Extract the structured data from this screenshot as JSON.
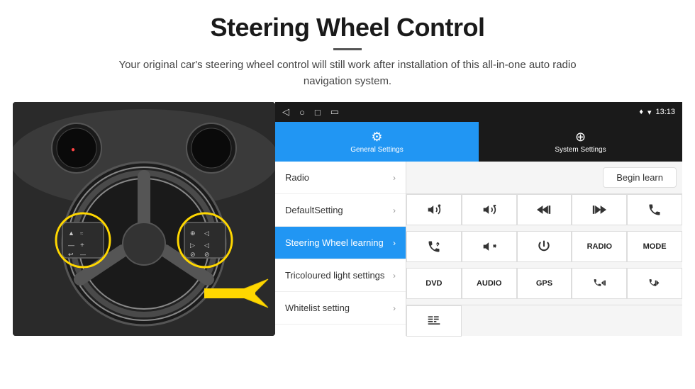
{
  "header": {
    "title": "Steering Wheel Control",
    "subtitle": "Your original car's steering wheel control will still work after installation of this all-in-one auto radio navigation system."
  },
  "status_bar": {
    "time": "13:13",
    "nav_icons": [
      "◁",
      "○",
      "□",
      "▭"
    ]
  },
  "tabs": [
    {
      "label": "General Settings",
      "active": true
    },
    {
      "label": "System Settings",
      "active": false
    }
  ],
  "menu_items": [
    {
      "label": "Radio",
      "active": false
    },
    {
      "label": "DefaultSetting",
      "active": false
    },
    {
      "label": "Steering Wheel learning",
      "active": true
    },
    {
      "label": "Tricoloured light settings",
      "active": false
    },
    {
      "label": "Whitelist setting",
      "active": false
    }
  ],
  "begin_learn_btn": "Begin learn",
  "icon_buttons": [
    {
      "type": "icon",
      "content": "vol_up",
      "row": 2
    },
    {
      "type": "icon",
      "content": "vol_down",
      "row": 2
    },
    {
      "type": "icon",
      "content": "prev",
      "row": 2
    },
    {
      "type": "icon",
      "content": "next",
      "row": 2
    },
    {
      "type": "icon",
      "content": "phone",
      "row": 2
    },
    {
      "type": "icon",
      "content": "back_call",
      "row": 3
    },
    {
      "type": "icon",
      "content": "mute",
      "row": 3
    },
    {
      "type": "icon",
      "content": "power",
      "row": 3
    },
    {
      "type": "text",
      "content": "RADIO",
      "row": 3
    },
    {
      "type": "text",
      "content": "MODE",
      "row": 3
    },
    {
      "type": "text",
      "content": "DVD",
      "row": 4
    },
    {
      "type": "text",
      "content": "AUDIO",
      "row": 4
    },
    {
      "type": "text",
      "content": "GPS",
      "row": 4
    },
    {
      "type": "icon",
      "content": "phone_prev",
      "row": 4
    },
    {
      "type": "icon",
      "content": "phone_next",
      "row": 4
    },
    {
      "type": "icon",
      "content": "list",
      "row": 5
    }
  ]
}
